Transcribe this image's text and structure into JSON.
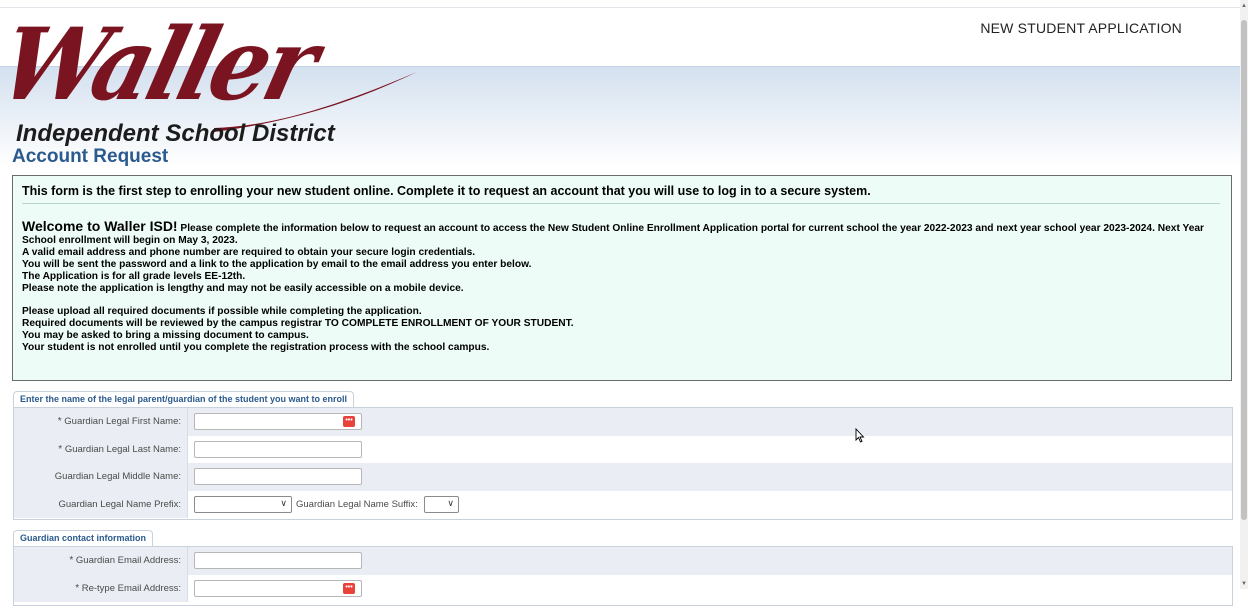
{
  "header": {
    "app_title": "NEW STUDENT APPLICATION",
    "logo_script": "Waller",
    "logo_subtitle": "Independent School District"
  },
  "page": {
    "title": "Account Request"
  },
  "info": {
    "headline": "This form is the first step to enrolling your new student online. Complete it to request an account that you will use to log in to a secure system.",
    "welcome_big": "Welcome to Waller ISD!",
    "welcome_rest": " Please complete the information below to request an account to access the New Student Online Enrollment Application portal for current school the year 2022-2023 and next year school year 2023-2024. Next Year School enrollment will begin on May 3, 2023.",
    "line_email_phone": "A valid email address and phone number are required to obtain your secure login credentials.",
    "line_password": "You will be sent the password and a link to the application by email to the email address you enter below.",
    "line_grades": "The Application is for all grade levels EE-12th.",
    "line_lengthy": "Please note the application is lengthy and may not be easily accessible on a mobile device.",
    "line_upload": "Please upload all required documents if possible while completing the application.",
    "line_reviewed": "Required documents will be reviewed by the campus registrar TO COMPLETE ENROLLMENT OF YOUR STUDENT.",
    "line_bring": "You may be asked to bring a missing document to campus.",
    "line_not_enrolled": "Your student is not enrolled until you complete the registration process with the school campus."
  },
  "guardian_section": {
    "tab_label": "Enter the name of the legal parent/guardian of the student you want to enroll",
    "first_name_label": "Guardian Legal First Name:",
    "first_name_value": "",
    "last_name_label": "Guardian Legal Last Name:",
    "last_name_value": "",
    "middle_name_label": "Guardian Legal Middle Name:",
    "middle_name_value": "",
    "prefix_label": "Guardian Legal Name Prefix:",
    "prefix_value": "",
    "suffix_label": "Guardian Legal Name Suffix:",
    "suffix_value": "",
    "required_marker": "*"
  },
  "contact_section": {
    "tab_label": "Guardian contact information",
    "email_label": "Guardian Email Address:",
    "email_value": "",
    "retype_email_label": "Re-type Email Address:",
    "retype_email_value": "",
    "required_marker": "*"
  },
  "icons": {
    "field_helper": "keyboard-helper-icon",
    "dropdown": "chevron-down-icon"
  },
  "colors": {
    "brand_maroon": "#7a1420",
    "title_blue": "#2b5a8e",
    "info_bg": "#edfcf6",
    "row_shade": "#eaeef4",
    "helper_red": "#e8423b"
  }
}
